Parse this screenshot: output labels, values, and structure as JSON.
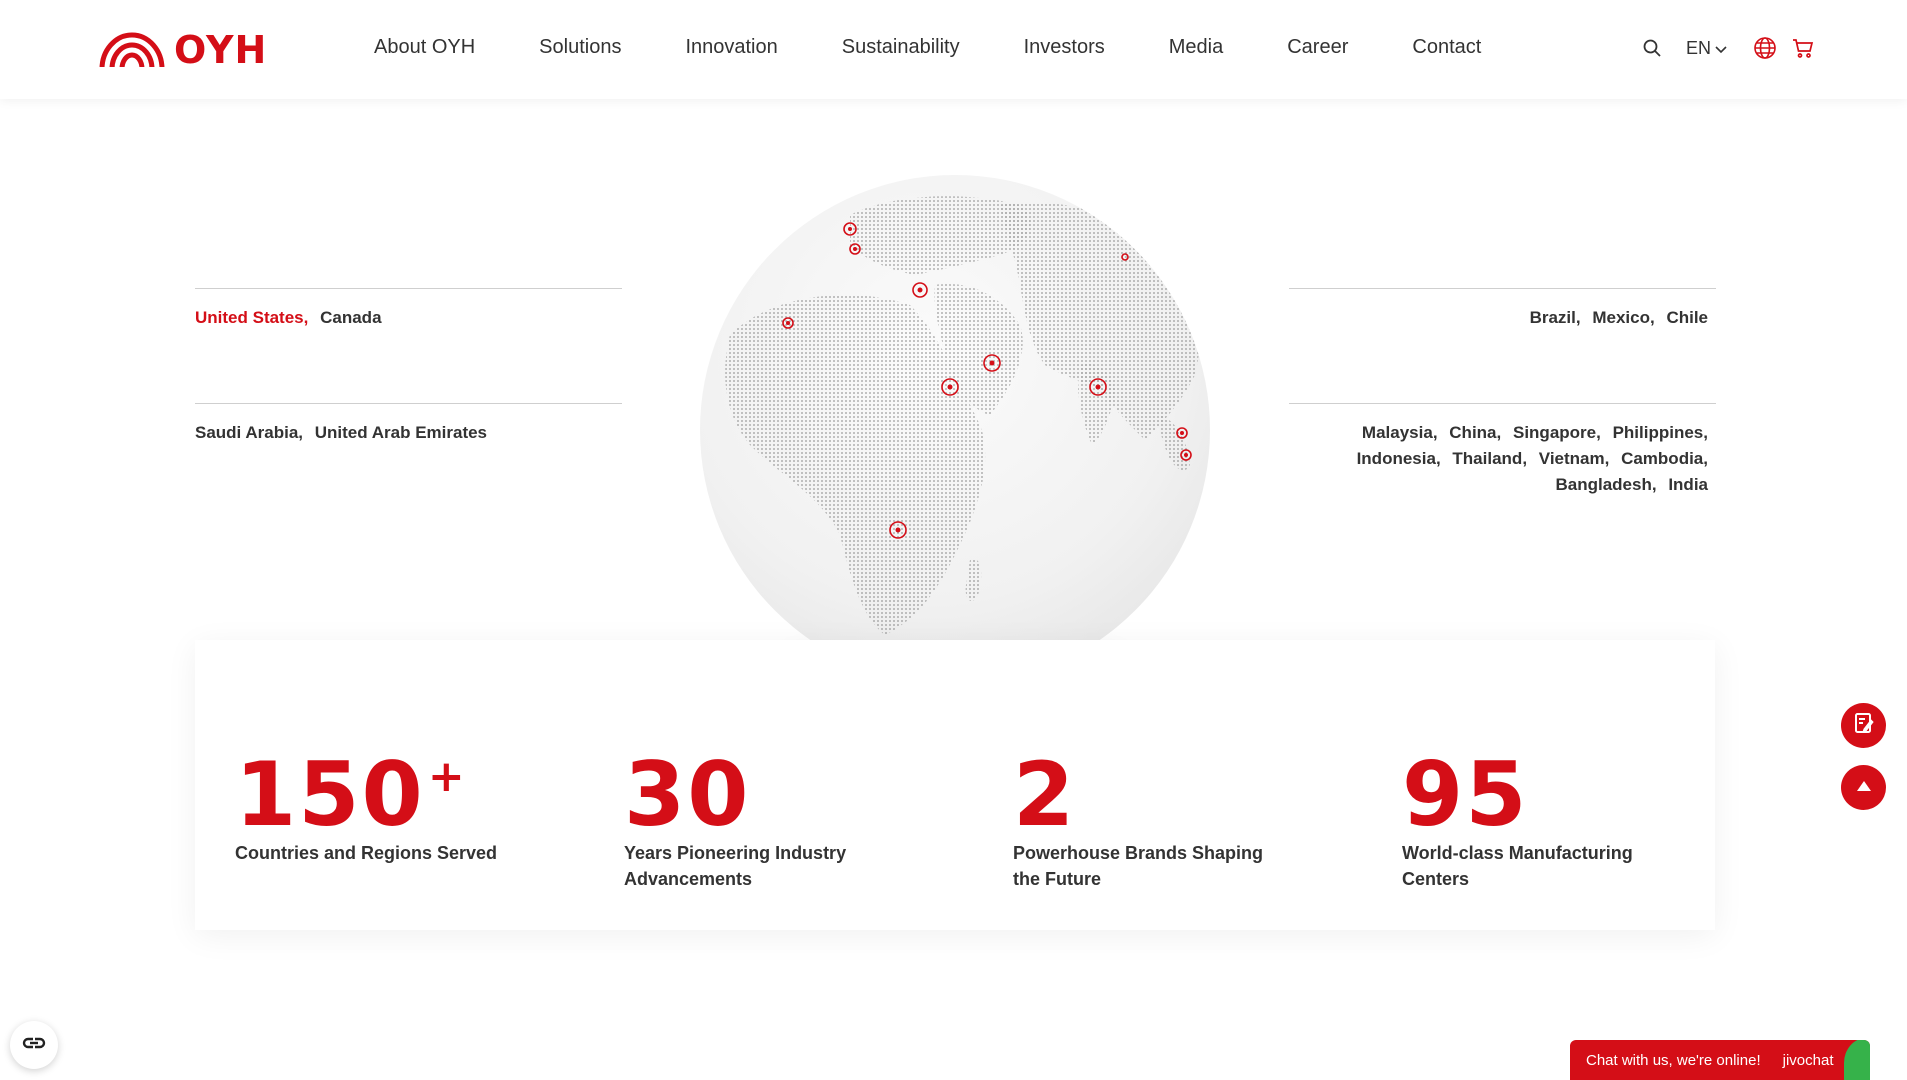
{
  "header": {
    "logo_text": "OYH",
    "brand_color": "#d40e17",
    "nav": [
      {
        "label": "About OYH"
      },
      {
        "label": "Solutions"
      },
      {
        "label": "Innovation"
      },
      {
        "label": "Sustainability"
      },
      {
        "label": "Investors"
      },
      {
        "label": "Media"
      },
      {
        "label": "Career"
      },
      {
        "label": "Contact"
      }
    ],
    "language": "EN",
    "icons": [
      "search-icon",
      "chevron-down-icon",
      "globe-icon",
      "cart-icon"
    ]
  },
  "regions": {
    "left_top": [
      {
        "name": "United States",
        "active": true
      },
      {
        "name": "Canada",
        "active": false
      }
    ],
    "left_bottom": [
      {
        "name": "Saudi Arabia"
      },
      {
        "name": "United Arab Emirates"
      }
    ],
    "right_top": [
      {
        "name": "Brazil"
      },
      {
        "name": "Mexico"
      },
      {
        "name": "Chile"
      }
    ],
    "right_bottom": [
      {
        "name": "Malaysia"
      },
      {
        "name": "China"
      },
      {
        "name": "Singapore"
      },
      {
        "name": "Philippines"
      },
      {
        "name": "Indonesia"
      },
      {
        "name": "Thailand"
      },
      {
        "name": "Vietnam"
      },
      {
        "name": "Cambodia"
      },
      {
        "name": "Bangladesh"
      },
      {
        "name": "India"
      }
    ]
  },
  "stats": [
    {
      "number": "150",
      "suffix": "+",
      "label_line1": "Countries and Regions Served",
      "label_line2": ""
    },
    {
      "number": "30",
      "suffix": "",
      "label_line1": "Years Pioneering Industry",
      "label_line2": "Advancements"
    },
    {
      "number": "2",
      "suffix": "",
      "label_line1": "Powerhouse Brands Shaping",
      "label_line2": "the Future"
    },
    {
      "number": "95",
      "suffix": "",
      "label_line1": "World-class Manufacturing",
      "label_line2": "Centers"
    }
  ],
  "floating": {
    "icons": [
      "edit-form-icon",
      "arrow-up-icon",
      "accessibility-icon"
    ]
  },
  "chat": {
    "text": "Chat with us, we're online!",
    "brand": "jivochat"
  }
}
